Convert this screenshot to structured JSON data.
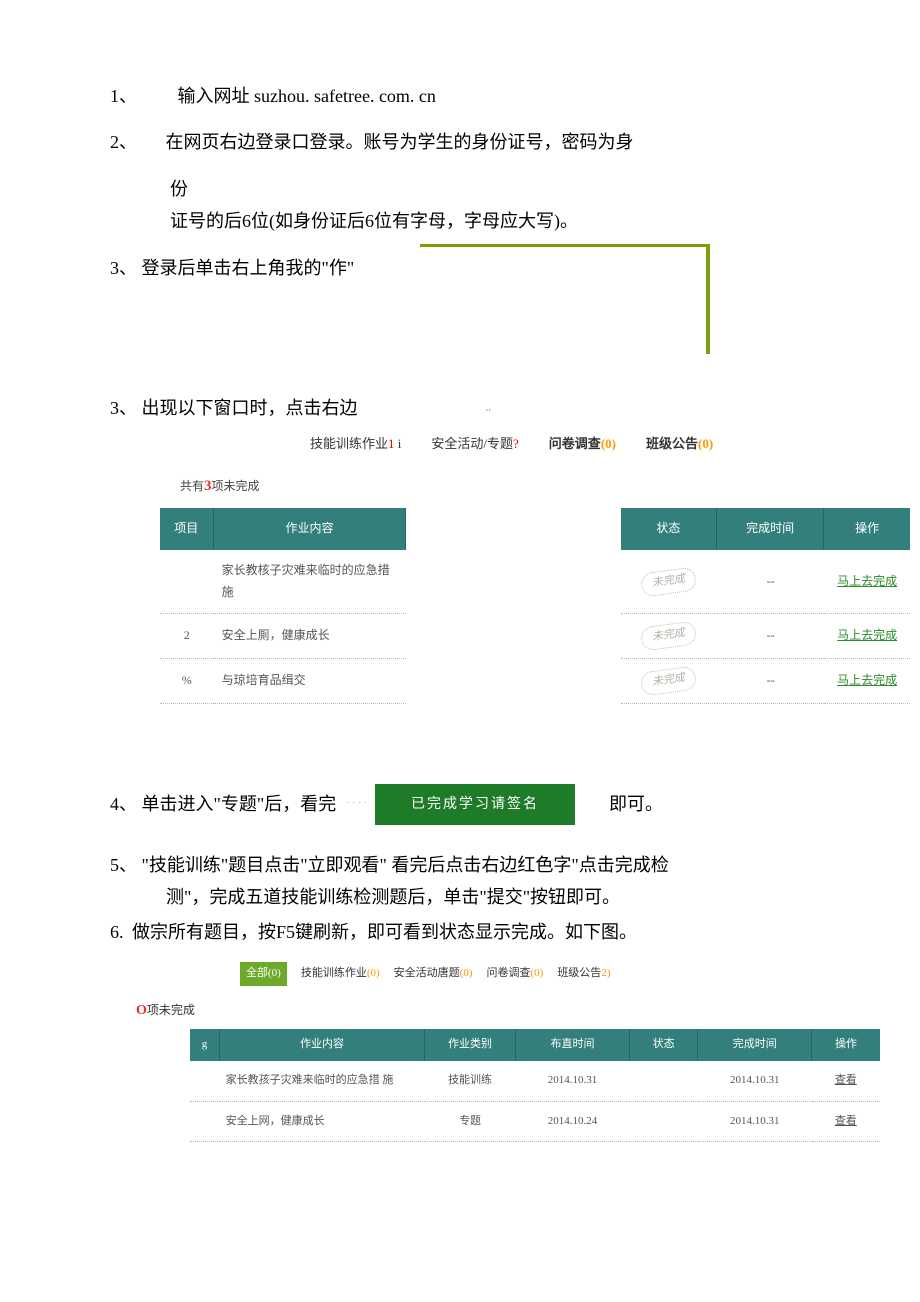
{
  "steps": {
    "s1_num": "1、",
    "s1_text": "输入网址 suzhou. safetree. com. cn",
    "s2_num": "2、",
    "s2_text_a": "在网页右边登录口登录。账号为学生的身份证号，密码为身",
    "s2_text_b": "份",
    "s2_text_c": "证号的后6位(如身份证后6位有字母，字母应大写)。",
    "s3_num": "3、",
    "s3_text": "登录后单击右上角我的\"作\"",
    "s3b_num": "3、",
    "s3b_text": "出现以下窗口时，点击右边",
    "s4_num": "4、",
    "s4_text_a": "单击进入\"专题\"后，看完",
    "s4_text_b": "即可。",
    "s5_num": "5、",
    "s5_text_a": "\"技能训练\"题目点击\"立即观看\"   看完后点击右边红色字\"点击完成检",
    "s5_text_b": "测\"，完成五道技能训练检测题后，单击\"提交\"按钮即可。",
    "s6_num": "6.",
    "s6_text": "做宗所有题目，按F5键刷新，即可看到状态显示完成。如下图。"
  },
  "tabs1": [
    {
      "label": "技能训练作业",
      "count": "1",
      "countClass": "count-red",
      "suffix": " i"
    },
    {
      "label": "安全活动/专题",
      "count": "?",
      "countClass": "count-red",
      "suffix": ""
    },
    {
      "label": "问卷调查",
      "count": "(0)",
      "countClass": "count-orange",
      "bold": true
    },
    {
      "label": "班级公告",
      "count": "(0)",
      "countClass": "count-orange",
      "bold": true
    }
  ],
  "incomplete1_prefix": "共有",
  "incomplete1_num": "3",
  "incomplete1_suffix": "项未完成",
  "table1": {
    "headers": {
      "col1": "项目",
      "col2": "作业内容",
      "col3": "状态",
      "col4": "完成时间",
      "col5": "操作"
    },
    "rows": [
      {
        "num": "",
        "content": "家长教核子灾难来临时的应急措施",
        "status": "未完成",
        "time": "--",
        "action": "马上去完成"
      },
      {
        "num": "2",
        "content": "安全上厠，健康成长",
        "status": "未完成",
        "time": "--",
        "action": "马上去完成"
      },
      {
        "num": "%",
        "content": "与琼培育品缉交",
        "status": "未完成",
        "time": "--",
        "action": "马上去完成"
      }
    ]
  },
  "green_button": "已完成学习请签名",
  "tabs2": {
    "all": "全部",
    "all_count": "(0)",
    "items": [
      {
        "label": "技能训练作业",
        "count": "(0)"
      },
      {
        "label": "安全活动唐题",
        "count": "(0)"
      },
      {
        "label": "问卷调查",
        "count": "(0)"
      },
      {
        "label": "班级公告",
        "count": "2)"
      }
    ]
  },
  "incomplete2_num": "O",
  "incomplete2_suffix": "项未完成",
  "table2": {
    "headers": {
      "col0": "g",
      "col1": "作业内容",
      "col2": "作业类别",
      "col3": "布直时间",
      "col4": "状态",
      "col5": "完成时间",
      "col6": "操作"
    },
    "rows": [
      {
        "content": "家长教孩子灾难来临时的应急措 施",
        "type": "技能训练",
        "ptime": "2014.10.31",
        "status": "",
        "ctime": "2014.10.31",
        "action": "查看"
      },
      {
        "content": "安全上网，健康成长",
        "type": "专题",
        "ptime": "2014.10.24",
        "status": "",
        "ctime": "2014.10.31",
        "action": "查看"
      }
    ]
  }
}
